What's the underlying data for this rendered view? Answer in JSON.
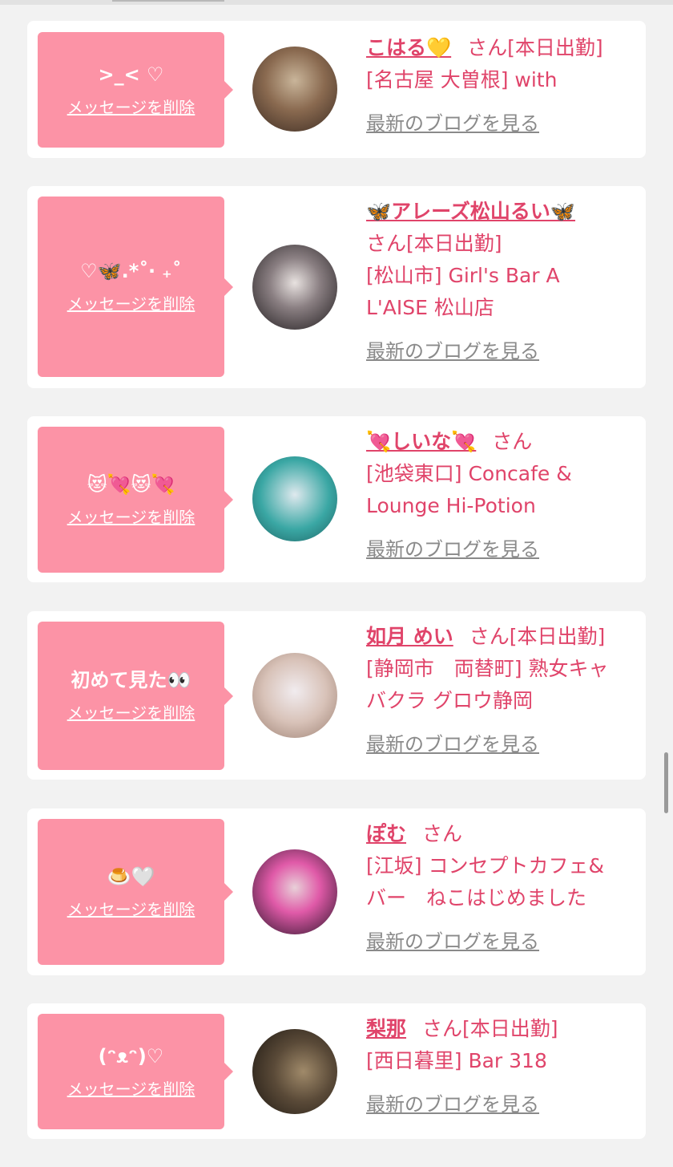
{
  "items": [
    {
      "message": ">_< ♡",
      "delete_label": "メッセージを削除",
      "name": "こはる💛",
      "san": "さん",
      "status": "[本日出勤]",
      "location_lines": [
        "[名古屋 大曽根] with"
      ],
      "blog_label": "最新のブログを見る",
      "avatar_colors": [
        "#6b4b3a",
        "#c9b59a"
      ]
    },
    {
      "message": "♡🦋.*˚‧ ₊˚",
      "delete_label": "メッセージを削除",
      "name": "🦋アレーズ松山るい🦋",
      "san": "さん",
      "status": "[本日出勤]",
      "location_lines": [
        "[松山市] Girl's Bar A",
        "L'AISE 松山店"
      ],
      "blog_label": "最新のブログを見る",
      "avatar_colors": [
        "#2a2528",
        "#e8e2e0"
      ]
    },
    {
      "message": "😻💘😻💘",
      "delete_label": "メッセージを削除",
      "name": "💘しいな💘",
      "san": "さん",
      "status": "",
      "location_lines": [
        "[池袋東口] Concafe &",
        "Lounge Hi-Potion"
      ],
      "blog_label": "最新のブログを見る",
      "avatar_colors": [
        "#3aa7a4",
        "#dfe9ee"
      ]
    },
    {
      "message": "初めて見た👀",
      "delete_label": "メッセージを削除",
      "name": "如月 めい",
      "san": "さん",
      "status": "[本日出勤]",
      "location_lines": [
        "[静岡市　両替町] 熟女キャ",
        "バクラ グロウ静岡"
      ],
      "blog_label": "最新のブログを見る",
      "avatar_colors": [
        "#d8c2b8",
        "#f1ecef"
      ]
    },
    {
      "message": "🍮🤍",
      "delete_label": "メッセージを削除",
      "name": "ぽむ",
      "san": "さん",
      "status": "",
      "location_lines": [
        "[江坂] コンセプトカフェ&",
        "バー　ねこはじめました"
      ],
      "blog_label": "最新のブログを見る",
      "avatar_colors": [
        "#3a1f3a",
        "#e05aa8"
      ]
    },
    {
      "message": "(ᵔᴥᵔ)♡",
      "delete_label": "メッセージを削除",
      "name": "梨那",
      "san": "さん",
      "status": "[本日出勤]",
      "location_lines": [
        "[西日暮里] Bar 318"
      ],
      "blog_label": "最新のブログを見る",
      "avatar_colors": [
        "#3a3128",
        "#a08a6a"
      ]
    }
  ]
}
